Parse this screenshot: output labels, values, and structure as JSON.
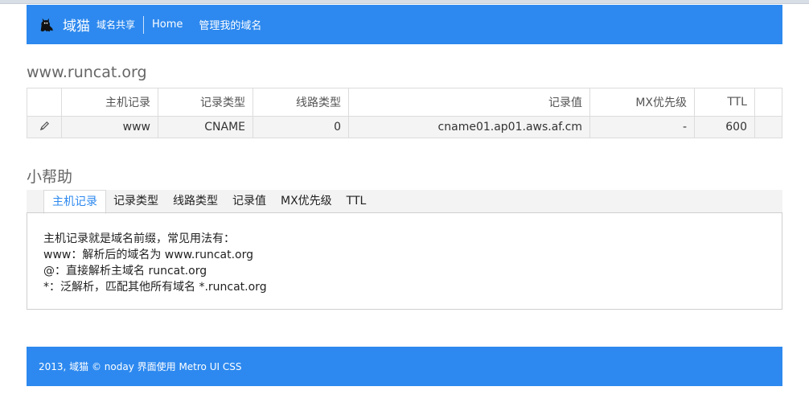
{
  "navbar": {
    "brand_name": "域猫",
    "brand_sub": "域名共享",
    "links": [
      "Home",
      "管理我的域名"
    ],
    "color": "#2d89ef"
  },
  "domain": {
    "title": "www.runcat.org"
  },
  "records": {
    "headers": [
      "主机记录",
      "记录类型",
      "线路类型",
      "记录值",
      "MX优先级",
      "TTL"
    ],
    "rows": [
      {
        "host": "www",
        "type": "CNAME",
        "line": "0",
        "value": "cname01.ap01.aws.af.cm",
        "mx": "-",
        "ttl": "600"
      }
    ]
  },
  "help": {
    "title": "小帮助",
    "tabs": [
      "主机记录",
      "记录类型",
      "线路类型",
      "记录值",
      "MX优先级",
      "TTL"
    ],
    "active_tab": 0,
    "lines": [
      "主机记录就是域名前缀，常见用法有：",
      "www：解析后的域名为 www.runcat.org",
      "@：直接解析主域名 runcat.org",
      "*：泛解析，匹配其他所有域名 *.runcat.org"
    ]
  },
  "footer": {
    "text": "2013, 域猫 © noday   界面使用 Metro UI CSS"
  },
  "icons": {
    "logo": "cat-icon",
    "edit": "pencil-icon"
  }
}
